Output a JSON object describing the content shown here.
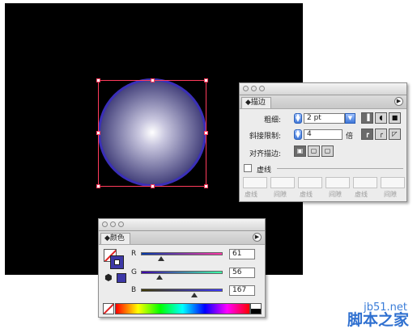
{
  "stroke_panel": {
    "tab_label": "◆描边",
    "weight_label": "粗细:",
    "weight_value": "2 pt",
    "miter_label": "斜接限制:",
    "miter_value": "4",
    "miter_unit": "倍",
    "align_label": "对齐描边:",
    "dashed_label": "虚线",
    "dash_labels": [
      "虚线",
      "间隙",
      "虚线",
      "间隙",
      "虚线",
      "间隙"
    ]
  },
  "color_panel": {
    "tab_label": "◆颜色",
    "channels": [
      {
        "name": "R",
        "value": "61",
        "fraction": 0.239
      },
      {
        "name": "G",
        "value": "56",
        "fraction": 0.22
      },
      {
        "name": "B",
        "value": "167",
        "fraction": 0.655
      }
    ],
    "fill_color": "#3d38a7"
  },
  "colors": {
    "artboard": "#000000",
    "selection": "#ff3b5c",
    "circle_stroke": "#3a2fb8"
  },
  "watermark": {
    "line1": "jb51.net",
    "line2": "脚本之家"
  }
}
